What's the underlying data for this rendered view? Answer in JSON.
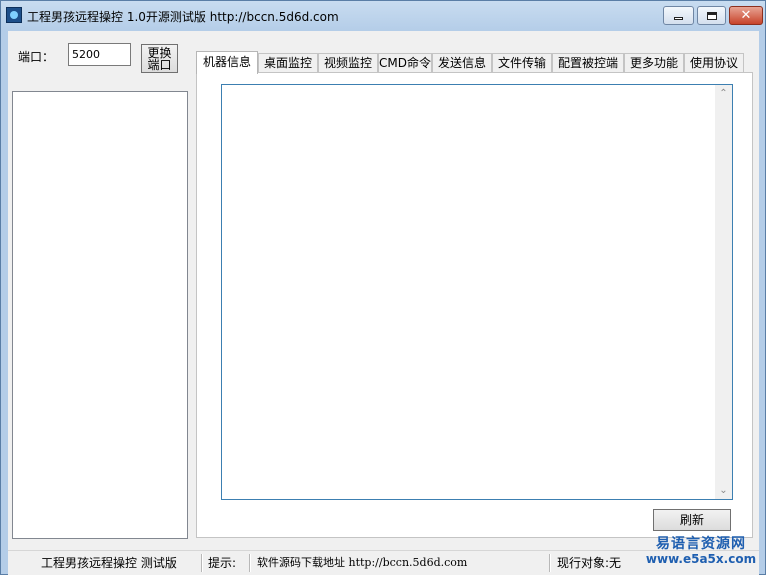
{
  "window": {
    "title": "工程男孩远程操控 1.0开源测试版 http://bccn.5d6d.com",
    "close_glyph": "✕"
  },
  "port": {
    "label": "端口：",
    "value": "5200",
    "change_button": "更换端口"
  },
  "tabs": [
    {
      "label": "机器信息"
    },
    {
      "label": "桌面监控"
    },
    {
      "label": "视频监控"
    },
    {
      "label": "CMD命令"
    },
    {
      "label": "发送信息"
    },
    {
      "label": "文件传输"
    },
    {
      "label": "配置被控端"
    },
    {
      "label": "更多功能"
    },
    {
      "label": "使用协议"
    }
  ],
  "info_panel": {
    "scroll_up": "⌃",
    "scroll_down": "⌄",
    "refresh_button": "刷新"
  },
  "status": {
    "app_name": "工程男孩远程操控 测试版",
    "hint_label": "提示:",
    "hint_text": "软件源码下载地址 http://bccn.5d6d.com",
    "current_target": "现行对象:无"
  },
  "watermark": {
    "line1": "易语言资源网",
    "line2": "www.e5a5x.com"
  },
  "colors": {
    "window_frame": "#b4cde8",
    "client_bg": "#f0f0f0",
    "text_area_border": "#3c7fb1",
    "watermark": "#1f5fb0"
  }
}
